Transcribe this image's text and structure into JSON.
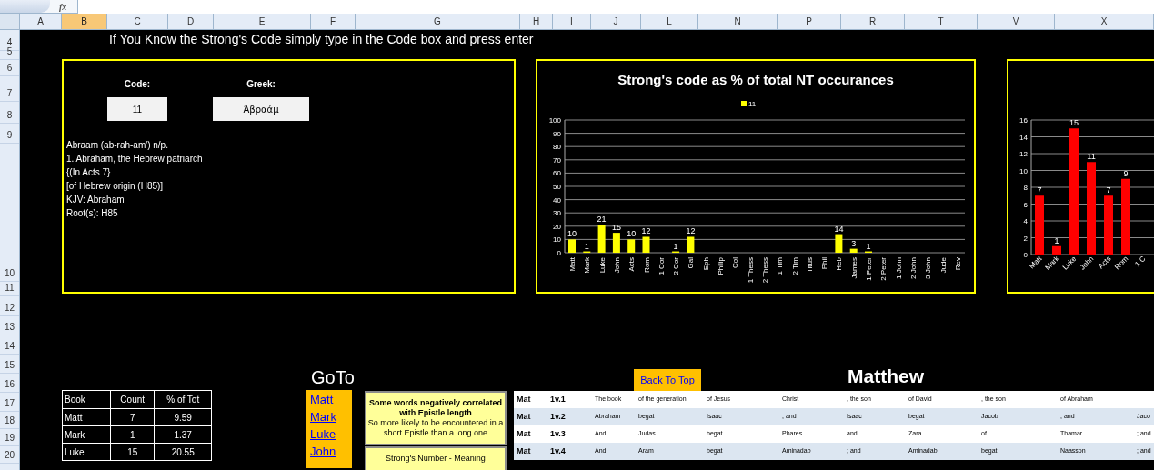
{
  "formula_bar": {
    "fx_label": "fx"
  },
  "columns": [
    {
      "label": "A",
      "selected": false
    },
    {
      "label": "B",
      "selected": true
    },
    {
      "label": "C",
      "selected": false
    },
    {
      "label": "D",
      "selected": false
    },
    {
      "label": "E",
      "selected": false
    },
    {
      "label": "F",
      "selected": false
    },
    {
      "label": "G",
      "selected": false
    },
    {
      "label": "H",
      "selected": false
    },
    {
      "label": "I",
      "selected": false
    },
    {
      "label": "J",
      "selected": false
    },
    {
      "label": "L",
      "selected": false
    },
    {
      "label": "N",
      "selected": false
    },
    {
      "label": "P",
      "selected": false
    },
    {
      "label": "R",
      "selected": false
    },
    {
      "label": "T",
      "selected": false
    },
    {
      "label": "V",
      "selected": false
    },
    {
      "label": "X",
      "selected": false
    }
  ],
  "rows": [
    "4",
    "5",
    "6",
    "7",
    "8",
    "9",
    "10",
    "11",
    "12",
    "13",
    "14",
    "15",
    "16",
    "17",
    "18",
    "19",
    "20"
  ],
  "instruction": "If You Know the Strong's Code simply type in the Code box and press enter",
  "lookup": {
    "code_label": "Code:",
    "code_value": "11",
    "greek_label": "Greek:",
    "greek_value": "Ἀβραάμ",
    "definition": [
      "Abraam (ab-rah-am') n/p.",
      "1. Abraham, the Hebrew patriarch",
      "{(In Acts 7}",
      "[of Hebrew origin (H85)]",
      "KJV: Abraham",
      "Root(s): H85"
    ]
  },
  "percent_chart": {
    "chart_data": {
      "type": "bar",
      "title": "Strong's code  as % of total NT occurances",
      "categories": [
        "Matt",
        "Mark",
        "Luke",
        "John",
        "Acts",
        "Rom",
        "1 Cor",
        "2 Cor",
        "Gal",
        "Eph",
        "Philip",
        "Col",
        "1 Thess",
        "2 Thess",
        "1 Tim",
        "2 Tim",
        "Titus",
        "Phil",
        "Heb",
        "James",
        "1 Peter",
        "2 Peter",
        "1 John",
        "2 John",
        "3 John",
        "Jude",
        "Rev"
      ],
      "series": [
        {
          "name": "11",
          "color": "#ffff00",
          "values": [
            10,
            1,
            21,
            15,
            10,
            12,
            null,
            1,
            12,
            null,
            null,
            null,
            null,
            null,
            null,
            null,
            null,
            null,
            14,
            3,
            1,
            null,
            null,
            null,
            null,
            null,
            null
          ]
        }
      ],
      "grid": true,
      "ylim": [
        0,
        100
      ],
      "yticks": [
        0,
        10,
        20,
        30,
        40,
        50,
        60,
        70,
        80,
        90,
        100
      ],
      "data_labels": true
    }
  },
  "count_chart": {
    "chart_data": {
      "type": "bar",
      "categories": [
        "Matt",
        "Mark",
        "Luke",
        "John",
        "Acts",
        "Rom",
        "1 C"
      ],
      "series": [
        {
          "color": "#ff0000",
          "values": [
            7,
            1,
            15,
            11,
            7,
            9,
            null
          ]
        }
      ],
      "grid": true,
      "ylim": [
        0,
        16
      ],
      "yticks": [
        0,
        2,
        4,
        6,
        8,
        10,
        12,
        14,
        16
      ],
      "data_labels": true
    }
  },
  "goto": {
    "title": "GoTo",
    "links": [
      "Matt",
      "Mark",
      "Luke",
      "John"
    ]
  },
  "count_table": {
    "columns": [
      "Book",
      "Count",
      "% of Tot"
    ],
    "rows": [
      [
        "Matt",
        "7",
        "9.59"
      ],
      [
        "Mark",
        "1",
        "1.37"
      ],
      [
        "Luke",
        "15",
        "20.55"
      ]
    ]
  },
  "note": {
    "heading": "Some words negatively correlated with Epistle length",
    "text": "So more likely to be encountered in a short Epistle than a long one",
    "meaning_heading": "Strong's Number - Meaning"
  },
  "back_to_top": "Back To Top",
  "book_title": "Matthew",
  "verses": [
    {
      "book": "Mat",
      "ref": "1v.1",
      "words": [
        "The book",
        "of the generation",
        "of Jesus",
        "Christ",
        ", the son",
        "of David",
        ", the son",
        "of Abraham"
      ]
    },
    {
      "book": "Mat",
      "ref": "1v.2",
      "words": [
        "Abraham",
        "begat",
        "Isaac",
        "; and",
        "Isaac",
        "begat",
        "Jacob",
        "; and",
        "Jaco"
      ]
    },
    {
      "book": "Mat",
      "ref": "1v.3",
      "words": [
        "And",
        "Judas",
        "begat",
        "Phares",
        "and",
        "Zara",
        "of",
        "Thamar",
        "; and"
      ]
    },
    {
      "book": "Mat",
      "ref": "1v.4",
      "words": [
        "And",
        "Aram",
        "begat",
        "Aminadab",
        "; and",
        "Aminadab",
        "begat",
        "Naasson",
        "; and"
      ]
    }
  ]
}
